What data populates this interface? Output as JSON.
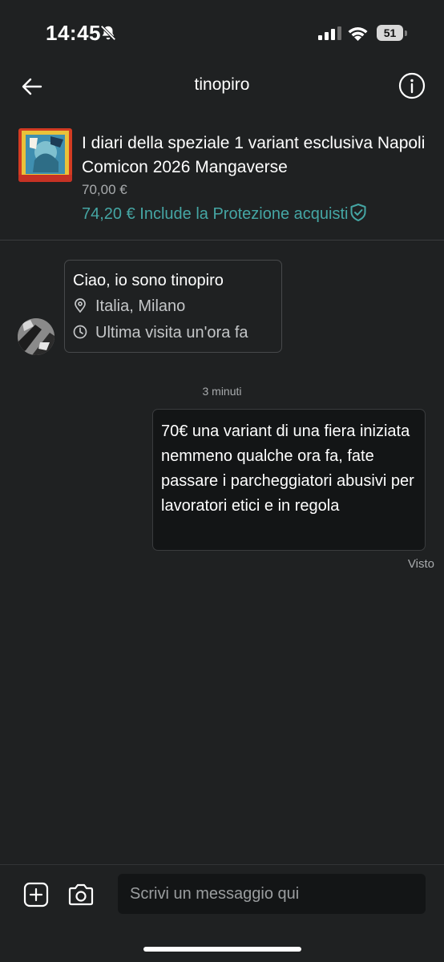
{
  "status_bar": {
    "time": "14:45",
    "battery": "51",
    "icons": [
      "bell-slash-icon",
      "signal-icon",
      "wifi-icon",
      "battery-icon"
    ]
  },
  "header": {
    "title": "tinopiro",
    "back_icon": "arrow-left-icon",
    "info_icon": "info-circle-icon"
  },
  "product": {
    "title": "I diari della speziale 1 variant esclusiva Napoli Comicon 2026 Mangaverse",
    "price": "70,00 €",
    "protection_text": "74,20 € Include la Protezione acquisti",
    "protection_icon": "shield-check-icon"
  },
  "intro": {
    "greeting": "Ciao, io sono tinopiro",
    "location": "Italia, Milano",
    "last_seen": "Ultima visita un'ora fa"
  },
  "conversation": {
    "timestamp": "3 minuti",
    "messages": [
      {
        "text": "70€ una variant di una fiera iniziata nemmeno qualche ora fa, fate passare i parcheggiatori abusivi per lavoratori etici e in regola",
        "status": "Visto"
      }
    ]
  },
  "composer": {
    "placeholder": "Scrivi un messaggio qui",
    "add_icon": "plus-square-icon",
    "camera_icon": "camera-icon"
  },
  "colors": {
    "background": "#1f2122",
    "accent": "#45a6a4",
    "bubble": "#131516"
  }
}
